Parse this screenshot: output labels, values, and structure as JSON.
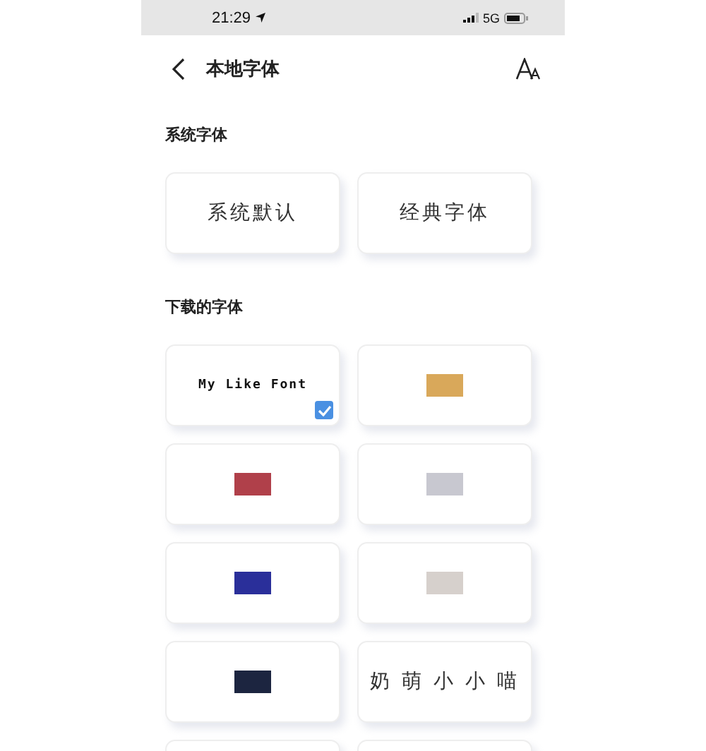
{
  "status_bar": {
    "time": "21:29",
    "network": "5G"
  },
  "header": {
    "title": "本地字体"
  },
  "sections": [
    {
      "title": "系统字体",
      "fonts": [
        {
          "kind": "text",
          "label": "系统默认",
          "selected": false
        },
        {
          "kind": "text",
          "label": "经典字体",
          "selected": false
        }
      ]
    },
    {
      "title": "下载的字体",
      "fonts": [
        {
          "kind": "mono",
          "label": "My Like Font",
          "selected": true
        },
        {
          "kind": "image",
          "color": "#d9a85a",
          "selected": false
        },
        {
          "kind": "image",
          "color": "#b0404a",
          "selected": false
        },
        {
          "kind": "image",
          "color": "#c8c8d0",
          "selected": false
        },
        {
          "kind": "image",
          "color": "#2a2f9a",
          "selected": false
        },
        {
          "kind": "image",
          "color": "#d6d0cc",
          "selected": false
        },
        {
          "kind": "image",
          "color": "#1c2540",
          "selected": false
        },
        {
          "kind": "text",
          "label": "奶 萌 小 小 喵",
          "selected": false
        },
        {
          "kind": "blank",
          "selected": false
        },
        {
          "kind": "blank",
          "selected": false
        }
      ]
    }
  ]
}
